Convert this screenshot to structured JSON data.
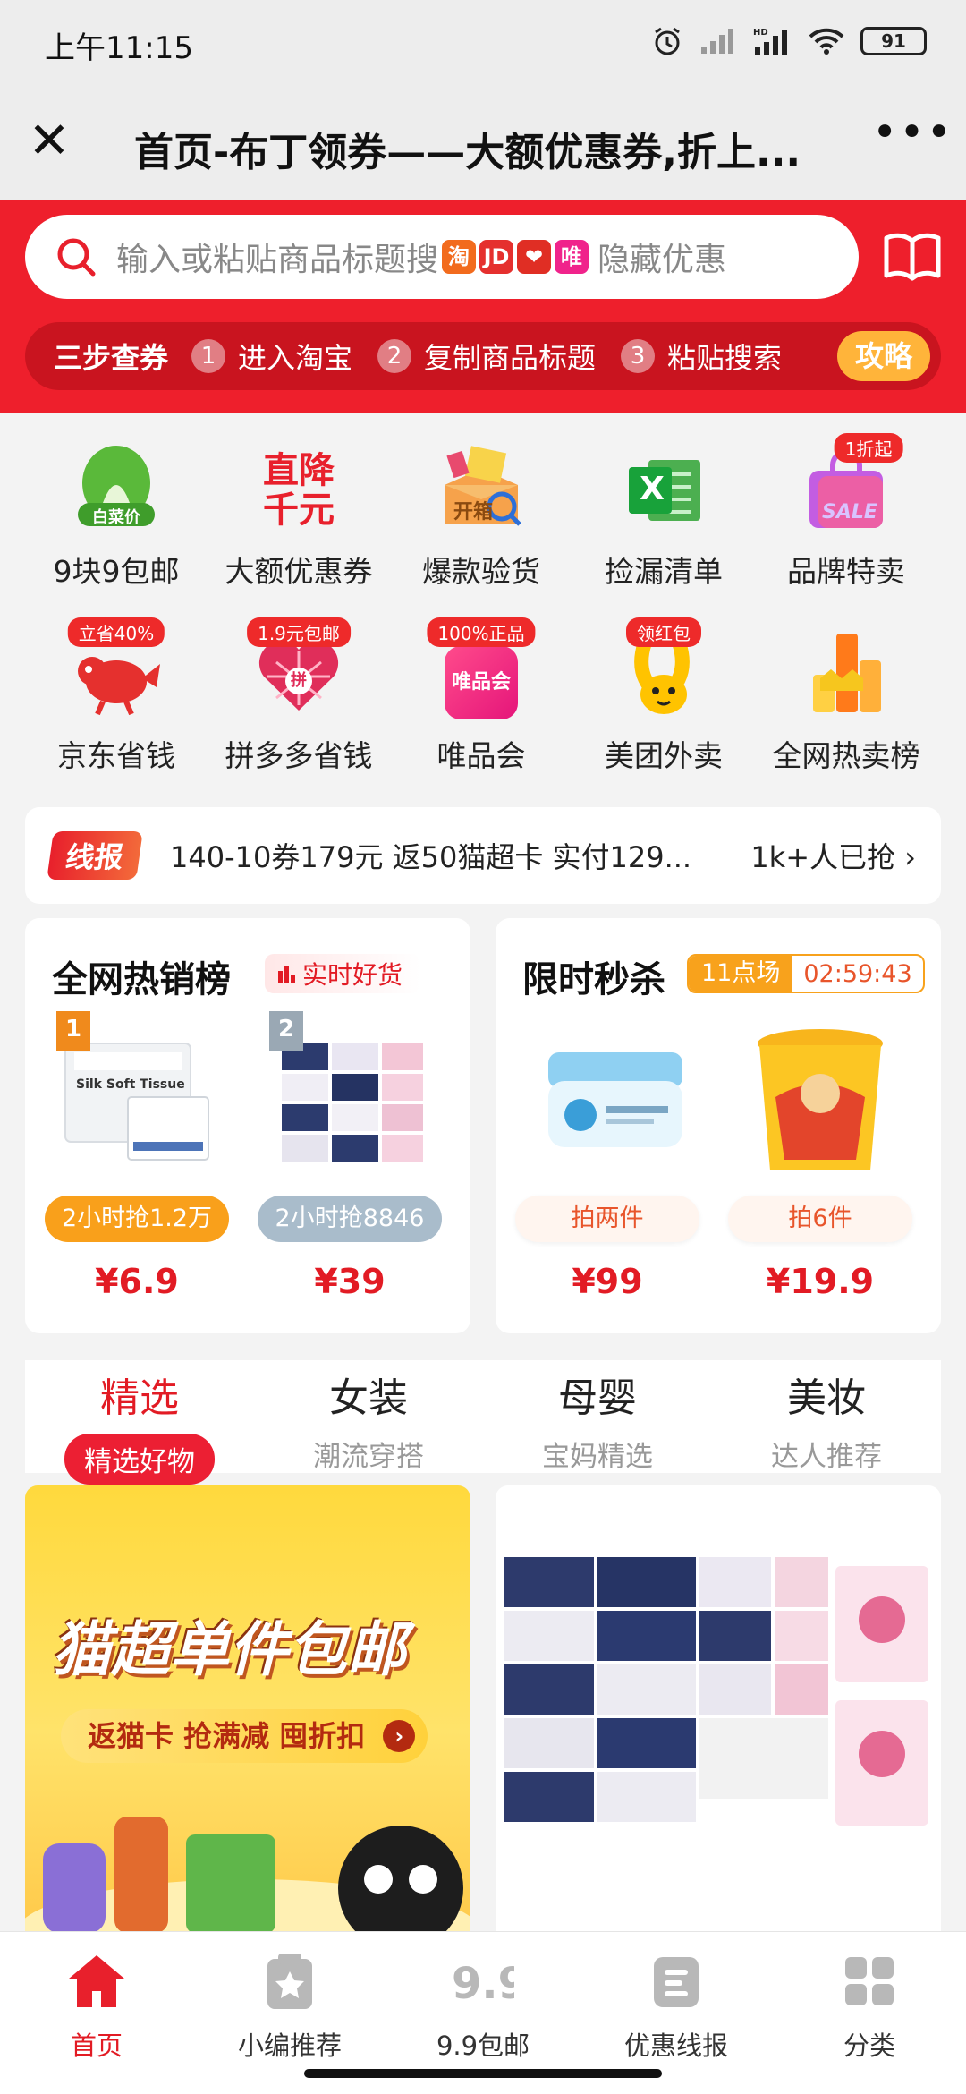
{
  "status_bar": {
    "time": "上午11:15",
    "battery": "91"
  },
  "title_bar": {
    "title": "首页-布丁领券——大额优惠券,折上...",
    "close_glyph": "✕",
    "more_glyph": "•••"
  },
  "search": {
    "placeholder": "输入或粘贴商品标题搜",
    "platform_badges": [
      {
        "text": "淘",
        "color": "#f26b1d"
      },
      {
        "text": "JD",
        "color": "#e5302e"
      },
      {
        "text": "❤",
        "color": "#e02e24"
      },
      {
        "text": "唯",
        "color": "#f0238b"
      }
    ],
    "tail_text": "隐藏优惠"
  },
  "steps": {
    "lead": "三步查券",
    "items": [
      {
        "num": "1",
        "text": "进入淘宝"
      },
      {
        "num": "2",
        "text": "复制商品标题"
      },
      {
        "num": "3",
        "text": "粘贴搜索"
      }
    ],
    "guide_button": "攻略"
  },
  "grid": {
    "row1": [
      {
        "label": "9块9包邮",
        "icon": "cabbage-icon",
        "icon_text": "白菜价",
        "tag": ""
      },
      {
        "label": "大额优惠券",
        "icon": "price-drop-icon",
        "icon_text": "直降千元",
        "tag": ""
      },
      {
        "label": "爆款验货",
        "icon": "inspection-box-icon",
        "icon_text": "开箱",
        "tag": ""
      },
      {
        "label": "捡漏清单",
        "icon": "excel-icon",
        "icon_text": "X",
        "tag": ""
      },
      {
        "label": "品牌特卖",
        "icon": "shopping-bag-icon",
        "icon_text": "SALE",
        "tag": "1折起"
      }
    ],
    "row2": [
      {
        "label": "京东省钱",
        "icon": "jd-dog-icon",
        "icon_text": "",
        "tag": "立省40%"
      },
      {
        "label": "拼多多省钱",
        "icon": "pinduoduo-icon",
        "icon_text": "拼",
        "tag": "1.9元包邮"
      },
      {
        "label": "唯品会",
        "icon": "vipshop-icon",
        "icon_text": "唯品会",
        "tag": "100%正品"
      },
      {
        "label": "美团外卖",
        "icon": "meituan-kangaroo-icon",
        "icon_text": "",
        "tag": "领红包"
      },
      {
        "label": "全网热卖榜",
        "icon": "ranking-bars-icon",
        "icon_text": "",
        "tag": ""
      }
    ]
  },
  "news": {
    "tag": "线报",
    "text": "140-10券179元 返50猫超卡 实付129...",
    "count": "1k+人已抢"
  },
  "hot_list": {
    "title": "全网热销榜",
    "badge": "实时好货",
    "items": [
      {
        "rank": "1",
        "pill": "2小时抢1.2万",
        "price": "¥6.9",
        "pill_color": "#f9a01b",
        "rank_color": "#f08a1c",
        "product_text": "Silk Soft Tissue"
      },
      {
        "rank": "2",
        "pill": "2小时抢8846",
        "price": "¥39",
        "pill_color": "#a9bccb",
        "rank_color": "#9aa8b4",
        "product_text": ""
      }
    ]
  },
  "flash_sale": {
    "title": "限时秒杀",
    "session": "11点场",
    "countdown": "02:59:43",
    "items": [
      {
        "pill": "拍两件",
        "price": "¥99"
      },
      {
        "pill": "拍6件",
        "price": "¥19.9"
      }
    ]
  },
  "tabs": [
    {
      "title": "精选",
      "subtitle": "精选好物"
    },
    {
      "title": "女装",
      "subtitle": "潮流穿搭"
    },
    {
      "title": "母婴",
      "subtitle": "宝妈精选"
    },
    {
      "title": "美妆",
      "subtitle": "达人推荐"
    }
  ],
  "feed": {
    "banner_title": "猫超单件包邮",
    "banner_sub": "返猫卡 抢满减 囤折扣"
  },
  "bottom_nav": [
    {
      "label": "首页",
      "icon": "home-icon"
    },
    {
      "label": "小编推荐",
      "icon": "editor-pick-icon"
    },
    {
      "label": "9.9包邮",
      "icon": "nine-nine-icon"
    },
    {
      "label": "优惠线报",
      "icon": "deal-news-icon"
    },
    {
      "label": "分类",
      "icon": "category-grid-icon"
    }
  ]
}
